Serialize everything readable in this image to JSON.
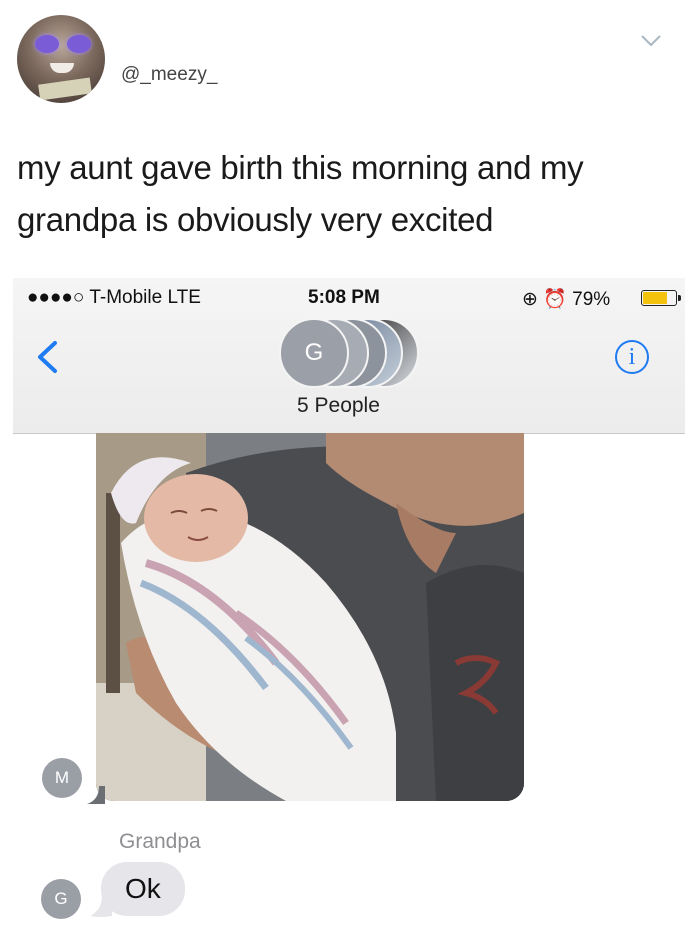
{
  "tweet": {
    "handle": "@_meezy_",
    "text": "my aunt gave birth this morning and my grandpa is obviously very excited"
  },
  "status_bar": {
    "carrier": "●●●●○ T-Mobile  LTE",
    "time": "5:08 PM",
    "right": "⊕ ⏰ 79%",
    "battery_percent": 79
  },
  "conversation": {
    "group_avatar_initial": "G",
    "participants_label": "5 People",
    "info_label": "i"
  },
  "messages": [
    {
      "type": "photo",
      "sender_initial": "M"
    },
    {
      "type": "text",
      "sender_name": "Grandpa",
      "sender_initial": "G",
      "text": "Ok"
    }
  ],
  "colors": {
    "ios_blue": "#1f7bf2",
    "incoming_bubble": "#e5e5ea",
    "battery_fill": "#f2c20c"
  },
  "icons": {
    "chevron": "chevron-down-icon",
    "back": "chevron-left-icon",
    "info": "info-icon",
    "lock_rotation": "lock-rotation-icon",
    "alarm": "alarm-icon"
  }
}
